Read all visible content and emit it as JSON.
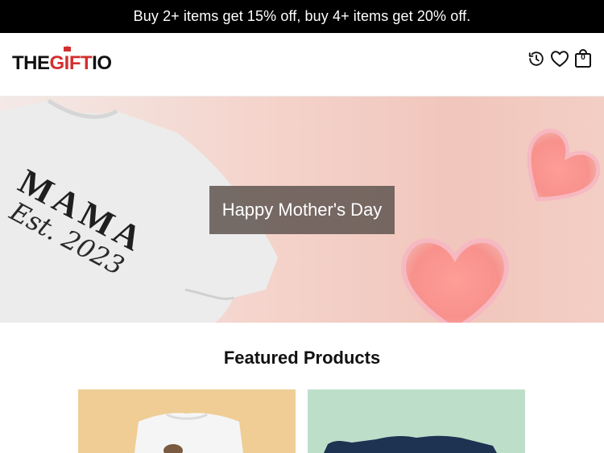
{
  "promo": {
    "text": "Buy 2+ items get 15% off, buy 4+ items get 20% off."
  },
  "header": {
    "logo": {
      "part1": "THE",
      "part2": "GIFT",
      "part3": "IO",
      "accent_color": "#d32f2f"
    },
    "icons": {
      "history": "history-icon",
      "wishlist": "heart-icon",
      "cart": "shopping-bag-icon"
    },
    "cart_count": "0"
  },
  "hero": {
    "caption": "Happy Mother's Day",
    "shirt_text_line1": "MAMA",
    "shirt_text_line2": "Est. 2023"
  },
  "featured": {
    "title": "Featured Products",
    "cards": [
      {
        "background": "#efcd95"
      },
      {
        "background": "#bddfca"
      }
    ]
  }
}
